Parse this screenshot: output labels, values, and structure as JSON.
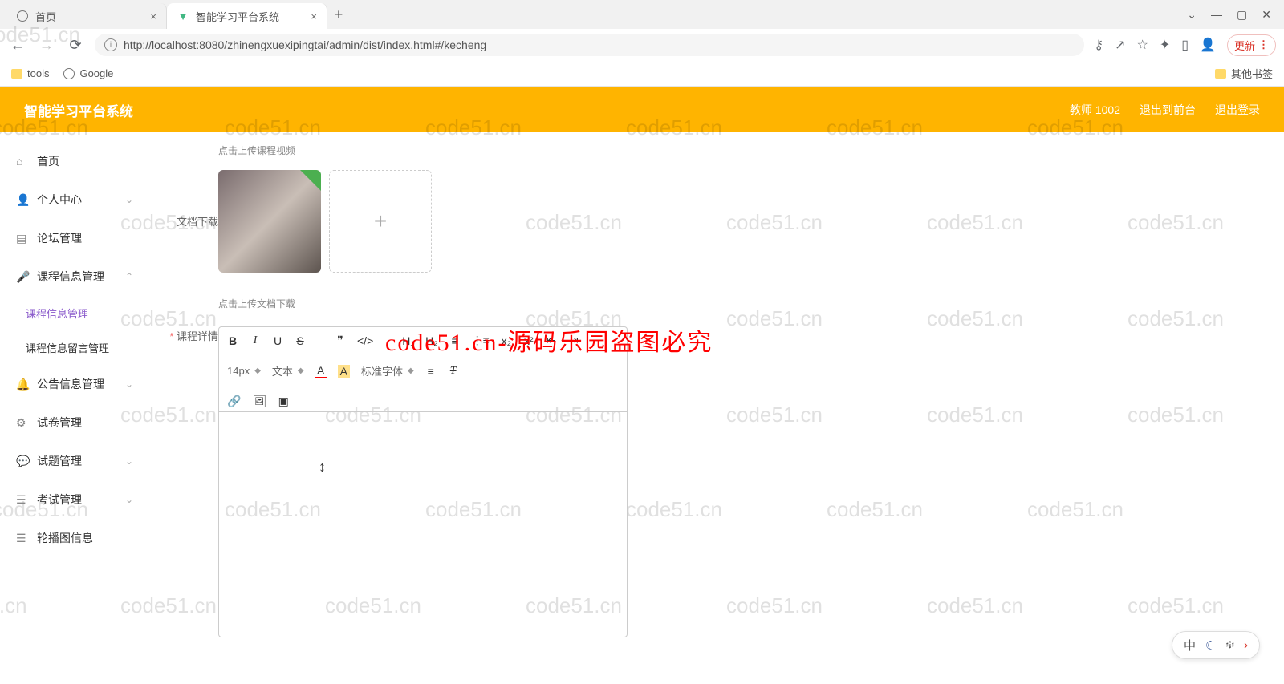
{
  "browser": {
    "tabs": [
      {
        "title": "首页",
        "icon": "globe"
      },
      {
        "title": "智能学习平台系统",
        "icon": "vue"
      }
    ],
    "url": "http://localhost:8080/zhinengxuexipingtai/admin/dist/index.html#/kecheng",
    "url_host": "localhost",
    "update_label": "更新",
    "bookmarks": [
      {
        "label": "tools",
        "type": "folder"
      },
      {
        "label": "Google",
        "type": "globe"
      }
    ],
    "other_bookmarks": "其他书签"
  },
  "app": {
    "title": "智能学习平台系统",
    "header_right": [
      "教师 1002",
      "退出到前台",
      "退出登录"
    ]
  },
  "sidebar": [
    {
      "icon": "home",
      "label": "首页",
      "type": "item"
    },
    {
      "icon": "user",
      "label": "个人中心",
      "type": "collapse",
      "open": false
    },
    {
      "icon": "book",
      "label": "论坛管理",
      "type": "item"
    },
    {
      "icon": "mic",
      "label": "课程信息管理",
      "type": "collapse",
      "open": true,
      "children": [
        {
          "label": "课程信息管理",
          "active": true
        },
        {
          "label": "课程信息留言管理",
          "active": false
        }
      ]
    },
    {
      "icon": "bell",
      "label": "公告信息管理",
      "type": "collapse",
      "open": false
    },
    {
      "icon": "gear",
      "label": "试卷管理",
      "type": "item"
    },
    {
      "icon": "chat",
      "label": "试题管理",
      "type": "collapse",
      "open": false
    },
    {
      "icon": "list",
      "label": "考试管理",
      "type": "collapse",
      "open": false
    },
    {
      "icon": "list",
      "label": "轮播图信息",
      "type": "item"
    }
  ],
  "form": {
    "video_hint": "点击上传课程视频",
    "doc_label": "文档下载",
    "doc_hint": "点击上传文档下载",
    "detail_label": "课程详情"
  },
  "editor": {
    "font_size": "14px",
    "block": "文本",
    "font_family": "标准字体",
    "h1": "H₁",
    "h2": "H₂",
    "subscript": "x₂",
    "superscript": "x²"
  },
  "watermark_text": "code51.cn",
  "red_watermark": "code51.cn-源码乐园盗图必究",
  "ime": {
    "mode": "中"
  }
}
